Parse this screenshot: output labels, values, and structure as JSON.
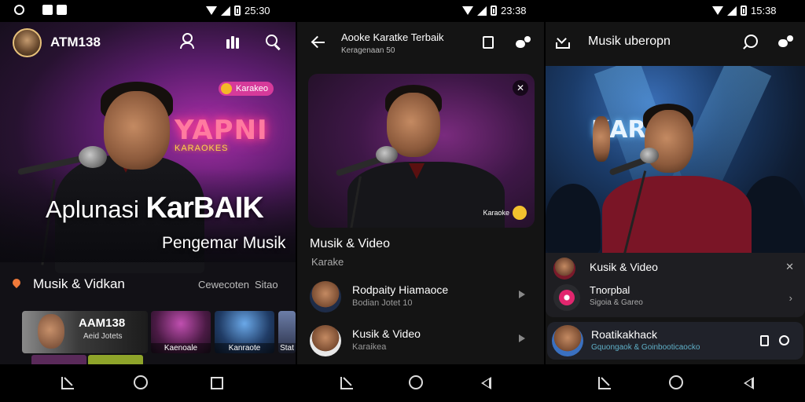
{
  "status": {
    "time_left": "25:30",
    "time_mid": "23:38",
    "time_right": "15:38"
  },
  "panel1": {
    "username": "ATM138",
    "chip_label": "Karakeo",
    "neon_sign": "YAPNI",
    "neon_sub": "KARAOKES",
    "hero_title_prefix": "Aplunasi ",
    "hero_title_main": "KarBAIK",
    "hero_subtitle": "Pengemar Musik",
    "section_title": "Musik & Vidkan",
    "section_link_1": "Cewecoten",
    "section_link_2": "Sitao",
    "thumbs": {
      "big_title": "AAM138",
      "big_sub": "Aeid Jotets",
      "t2_label": "Kaenoale",
      "t3_label": "Kanraote",
      "t4_label": "Stat"
    }
  },
  "panel2": {
    "header_title": "Aooke Karatke Terbaik",
    "header_sub": "Keragenaan 50",
    "card_tag": "Karaoke",
    "section_title": "Musik & Video",
    "section_sub": "Karake",
    "items": [
      {
        "title": "Rodpaity Hiamaoce",
        "sub": "Bodian Jotet 10"
      },
      {
        "title": "Kusik & Video",
        "sub": "Karaikea"
      }
    ]
  },
  "panel3": {
    "header_title": "Musik uberopn",
    "stage_sign": "KARAN",
    "list": [
      {
        "title": "Kusik & Video"
      },
      {
        "title": "Tnorpbal",
        "sub": "Sigoia & Gareo"
      }
    ],
    "now_playing": {
      "title": "Roatikakhack",
      "sub": "Gquongaok & Goinbooticaocko"
    }
  },
  "colors": {
    "accent_pink": "#d63a9a",
    "accent_yellow": "#f4b829",
    "stage_blue": "#3a6fb8"
  }
}
